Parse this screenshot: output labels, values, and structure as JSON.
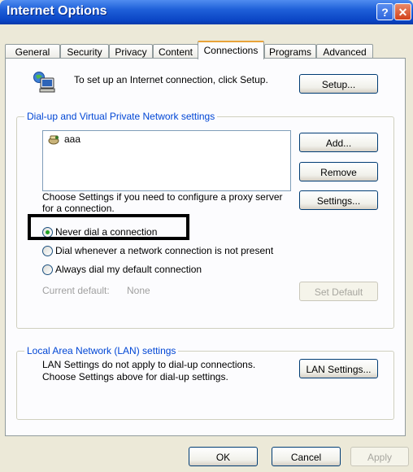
{
  "window": {
    "title": "Internet Options"
  },
  "titlebar_buttons": {
    "help": "?",
    "close": "✕"
  },
  "tabs": [
    "General",
    "Security",
    "Privacy",
    "Content",
    "Connections",
    "Programs",
    "Advanced"
  ],
  "active_tab": "Connections",
  "setup": {
    "text": "To set up an Internet connection, click Setup.",
    "button": "Setup..."
  },
  "dialup_group": {
    "label": "Dial-up and Virtual Private Network settings",
    "connections": [
      "aaa"
    ],
    "add_button": "Add...",
    "remove_button": "Remove",
    "settings_text": "Choose Settings if you need to configure a proxy server for a connection.",
    "settings_button": "Settings...",
    "radio_options": [
      {
        "label": "Never dial a connection",
        "selected": true
      },
      {
        "label": "Dial whenever a network connection is not present",
        "selected": false
      },
      {
        "label": "Always dial my default connection",
        "selected": false
      }
    ],
    "current_default_label": "Current default:",
    "current_default_value": "None",
    "set_default_button": "Set Default"
  },
  "lan_group": {
    "label": "Local Area Network (LAN) settings",
    "text": "LAN Settings do not apply to dial-up connections. Choose Settings above for dial-up settings.",
    "button": "LAN Settings..."
  },
  "footer": {
    "ok": "OK",
    "cancel": "Cancel",
    "apply": "Apply"
  },
  "icons": {
    "setup": "network-computer-icon",
    "connection": "dialup-connection-icon"
  }
}
